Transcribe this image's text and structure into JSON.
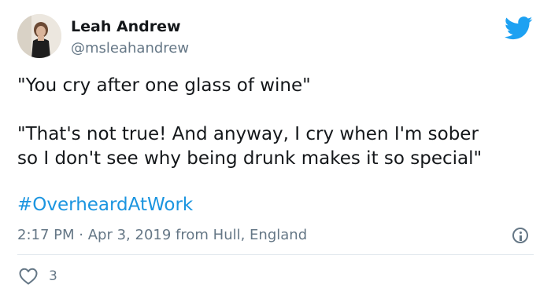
{
  "author": {
    "name": "Leah Andrew",
    "handle": "@msleahandrew"
  },
  "tweet": {
    "line1": "\"You cry after one glass of wine\"",
    "line2a": "\"That's not true! And anyway, I cry when I'm sober",
    "line2b": "so I don't see why being drunk makes it so special\"",
    "hashtag": "#OverheardAtWork",
    "time": "2:17 PM",
    "separator": "·",
    "date": "Apr 3, 2019",
    "source": "from Hull, England"
  },
  "actions": {
    "likes": "3"
  },
  "icons": {
    "brand": "twitter-bird-icon",
    "info": "info-icon",
    "like": "heart-icon"
  },
  "colors": {
    "accent": "#1b95e0",
    "secondary_text": "#657786",
    "primary_text": "#14171a"
  }
}
